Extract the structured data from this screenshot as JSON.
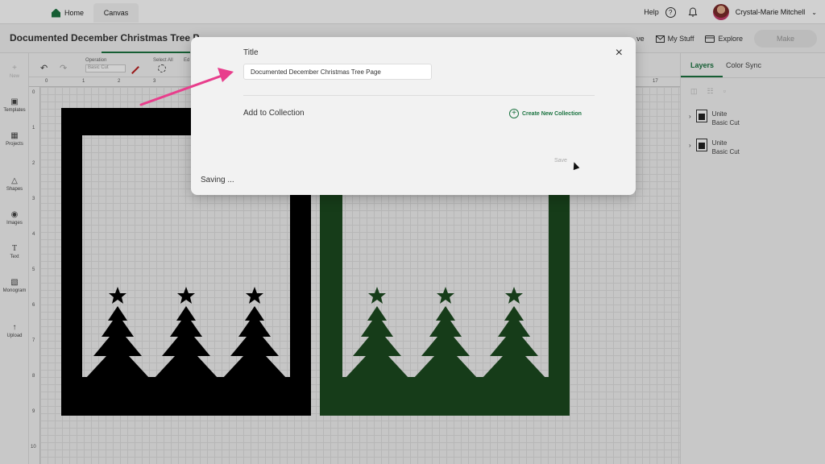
{
  "topbar": {
    "home_label": "Home",
    "canvas_label": "Canvas",
    "help_label": "Help",
    "help_icon_glyph": "?",
    "user_name": "Crystal-Marie Mitchell"
  },
  "project": {
    "title": "Documented December Christmas Tree P",
    "save_label": "ve",
    "mystuff_label": "My Stuff",
    "explore_label": "Explore",
    "make_label": "Make"
  },
  "sidebar": {
    "items": [
      {
        "label": "New"
      },
      {
        "label": "Templates"
      },
      {
        "label": "Projects"
      },
      {
        "label": "Shapes"
      },
      {
        "label": "Images"
      },
      {
        "label": "Text"
      },
      {
        "label": "Monogram"
      },
      {
        "label": "Upload"
      }
    ]
  },
  "toolbar": {
    "operation_label": "Operation",
    "operation_value": "Basic Cut",
    "select_all_label": "Select All",
    "edit_label": "Ed"
  },
  "rulers": {
    "top": [
      "0",
      "1",
      "2",
      "3",
      "17"
    ],
    "left": [
      "0",
      "1",
      "2",
      "3",
      "4",
      "5",
      "6",
      "7",
      "8",
      "9",
      "10"
    ]
  },
  "right_panel": {
    "tabs": [
      "Layers",
      "Color Sync"
    ],
    "layers": [
      {
        "name": "Unite",
        "op": "Basic Cut"
      },
      {
        "name": "Unite",
        "op": "Basic Cut"
      }
    ]
  },
  "modal": {
    "title_label": "Title",
    "title_value": "Documented December Christmas Tree Page",
    "close_glyph": "×",
    "collection_label": "Add to Collection",
    "create_label": "Create New Collection",
    "save_label": "Save",
    "status_text": "Saving ..."
  },
  "colors": {
    "accent": "#1b7340",
    "art_black": "#000000",
    "art_green": "#1c4a1f",
    "annotation_arrow": "#e83e8c"
  }
}
